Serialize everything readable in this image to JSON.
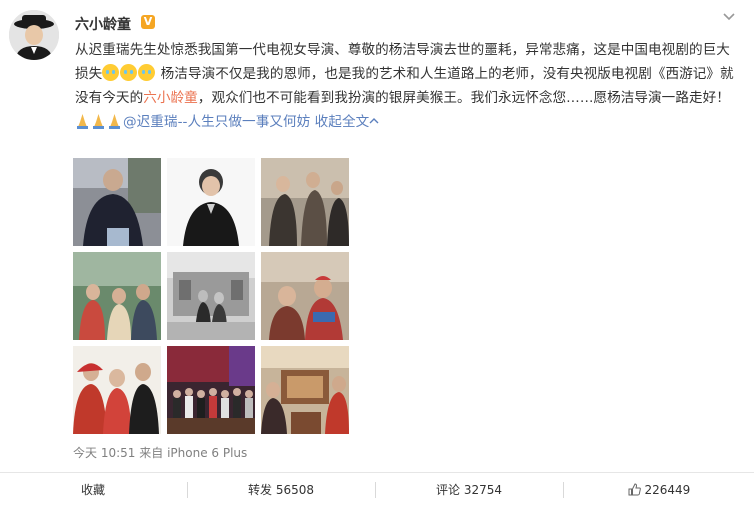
{
  "author": {
    "name": "六小龄童",
    "badge": "V"
  },
  "post": {
    "part1": "从迟重瑞先生处惊悉我国第一代电视女导演、尊敬的杨洁导演去世的噩耗，异常悲痛，这是中国电视剧的巨大损失",
    "part2": " 杨洁导演不仅是我的恩师，也是我的艺术和人生道路上的老师，没有央视版电视剧《西游记》就没有今天的",
    "mention_self": "六小龄童",
    "part3": "，观众们也不可能看到我扮演的银屏美猴王。我们永远怀念您……愿杨洁导演一路走好！",
    "mention": "@迟重瑞--人生只做一事又何妨",
    "collapse": "收起全文"
  },
  "emoji": {
    "crying": "crying-emoji",
    "pray": "pray-emoji"
  },
  "meta": {
    "time": "今天 10:51",
    "from_label": "来自",
    "device": "iPhone 6 Plus"
  },
  "actions": {
    "favorite": "收藏",
    "repost": "转发 56508",
    "comment": "评论 32754",
    "like": "226449"
  },
  "colors": {
    "highlight": "#eb7350",
    "link": "#5b7fbd",
    "vip": "#f5a623"
  }
}
